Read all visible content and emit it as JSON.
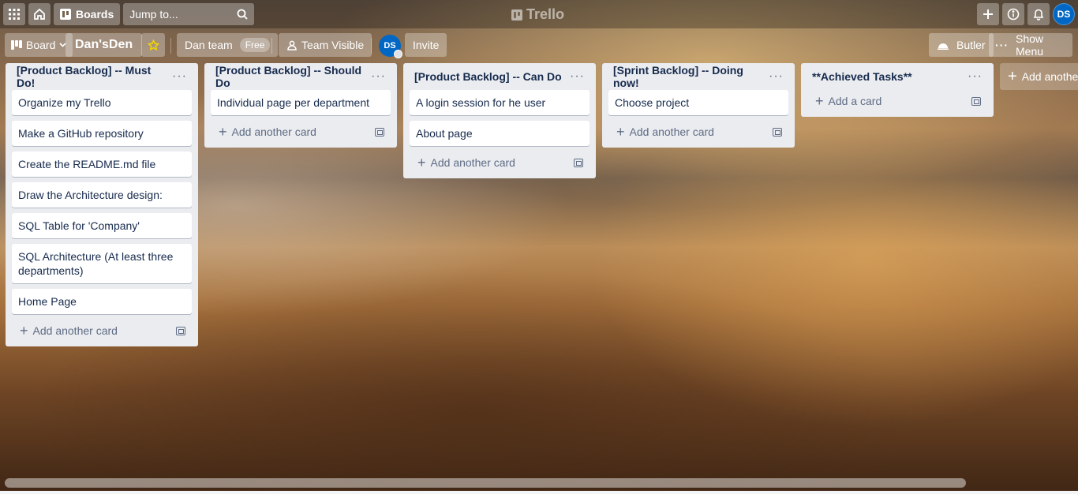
{
  "header": {
    "boards_label": "Boards",
    "search_placeholder": "Jump to...",
    "logo_text": "Trello",
    "user_initials": "DS"
  },
  "board": {
    "view_label": "Board",
    "title": "Dan'sDen",
    "team_name": "Dan team",
    "team_plan": "Free",
    "visibility": "Team Visible",
    "member_initials": "DS",
    "invite_label": "Invite",
    "butler_label": "Butler",
    "menu_label": "Show Menu"
  },
  "lists": [
    {
      "title": "[Product Backlog] -- Must Do!",
      "cards": [
        "Organize my Trello",
        "Make a GitHub repository",
        "Create the README.md file",
        "Draw the Architecture design:",
        "SQL Table for 'Company'",
        "SQL Architecture (At least three departments)",
        "Home Page"
      ],
      "add_label": "Add another card"
    },
    {
      "title": "[Product Backlog] -- Should Do",
      "cards": [
        "Individual page per department"
      ],
      "add_label": "Add another card"
    },
    {
      "title": "[Product Backlog] -- Can Do",
      "cards": [
        "A login session for he user",
        "About page"
      ],
      "add_label": "Add another card"
    },
    {
      "title": "[Sprint Backlog] -- Doing now!",
      "cards": [
        "Choose project"
      ],
      "add_label": "Add another card"
    },
    {
      "title": "**Achieved Tasks**",
      "cards": [],
      "add_label": "Add a card"
    }
  ],
  "add_list_label": "Add another list",
  "colors": {
    "list_bg": "#ebecf0",
    "avatar": "#0067c5",
    "star": "#f2d600"
  }
}
